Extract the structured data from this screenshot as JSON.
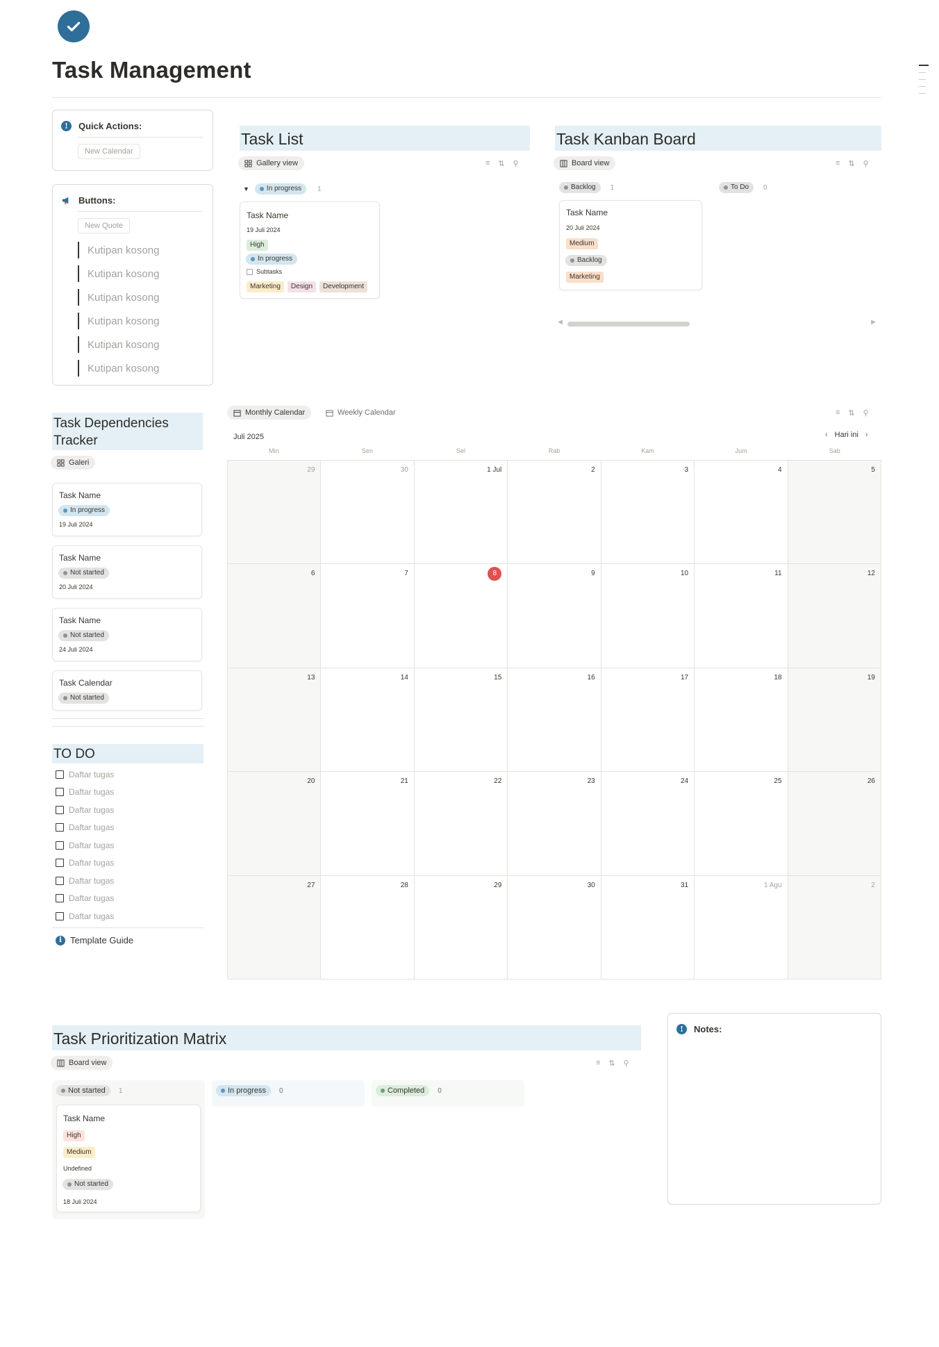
{
  "page": {
    "title": "Task Management"
  },
  "quick_actions": {
    "heading": "Quick Actions:",
    "button": "New Calendar"
  },
  "buttons_box": {
    "heading": "Buttons:",
    "button": "New Quote",
    "quotes": [
      "Kutipan kosong",
      "Kutipan kosong",
      "Kutipan kosong",
      "Kutipan kosong",
      "Kutipan kosong",
      "Kutipan kosong"
    ]
  },
  "task_list": {
    "title": "Task List",
    "view": "Gallery view",
    "group": {
      "label": "In progress",
      "count": "1"
    },
    "card": {
      "name": "Task Name",
      "date": "19 Juli 2024",
      "priority": "High",
      "status": "In progress",
      "subtasks": "Subtasks",
      "tags": [
        "Marketing",
        "Design",
        "Development"
      ]
    }
  },
  "kanban": {
    "title": "Task Kanban Board",
    "view": "Board view",
    "columns": [
      {
        "label": "Backlog",
        "count": "1"
      },
      {
        "label": "To Do",
        "count": "0"
      }
    ],
    "card": {
      "name": "Task Name",
      "date": "20 Juli 2024",
      "priority": "Medium",
      "status": "Backlog",
      "tag": "Marketing"
    }
  },
  "dependencies": {
    "title": "Task Dependencies Tracker",
    "view": "Galeri",
    "cards": [
      {
        "name": "Task Name",
        "status": "In progress",
        "date": "19 Juli 2024"
      },
      {
        "name": "Task Name",
        "status": "Not started",
        "date": "20 Juli 2024"
      },
      {
        "name": "Task Name",
        "status": "Not started",
        "date": "24 Juli 2024"
      },
      {
        "name": "Task Calendar",
        "status": "Not started",
        "date": ""
      }
    ]
  },
  "todo": {
    "title": "TO DO",
    "items": [
      "Daftar tugas",
      "Daftar tugas",
      "Daftar tugas",
      "Daftar tugas",
      "Daftar tugas",
      "Daftar tugas",
      "Daftar tugas",
      "Daftar tugas",
      "Daftar tugas"
    ],
    "guide": "Template Guide"
  },
  "calendar": {
    "tabs": [
      "Monthly Calendar",
      "Weekly Calendar"
    ],
    "month": "Juli 2025",
    "today_btn": "Hari ini",
    "weekdays": [
      "Min",
      "Sen",
      "Sel",
      "Rab",
      "Kam",
      "Jum",
      "Sab"
    ],
    "weeks": [
      [
        "29",
        "30",
        "1 Jul",
        "2",
        "3",
        "4",
        "5"
      ],
      [
        "6",
        "7",
        "8",
        "9",
        "10",
        "11",
        "12"
      ],
      [
        "13",
        "14",
        "15",
        "16",
        "17",
        "18",
        "19"
      ],
      [
        "20",
        "21",
        "22",
        "23",
        "24",
        "25",
        "26"
      ],
      [
        "27",
        "28",
        "29",
        "30",
        "31",
        "1 Agu",
        "2"
      ]
    ]
  },
  "matrix": {
    "title": "Task Prioritization Matrix",
    "view": "Board view",
    "columns": [
      {
        "label": "Not started",
        "count": "1"
      },
      {
        "label": "In progress",
        "count": "0"
      },
      {
        "label": "Completed",
        "count": "0"
      }
    ],
    "card": {
      "name": "Task Name",
      "priority": "High",
      "level": "Medium",
      "extra": "Undefined",
      "status": "Not started",
      "date": "18 Juli 2024"
    }
  },
  "notes": {
    "heading": "Notes:"
  },
  "colors": {
    "accent": "#2e6e98",
    "heading_bg": "#e4f0f6",
    "today": "#e05050",
    "in_progress": "#d3e5ef",
    "not_started": "#e3e2e0",
    "completed": "#dbeddb"
  },
  "icons": [
    "check-icon",
    "info-icon",
    "megaphone-icon",
    "gallery-icon",
    "board-icon",
    "calendar-icon",
    "filter-icon",
    "sort-icon",
    "search-icon",
    "chevron-left-icon",
    "chevron-right-icon",
    "triangle-down-icon",
    "checkbox-icon"
  ]
}
